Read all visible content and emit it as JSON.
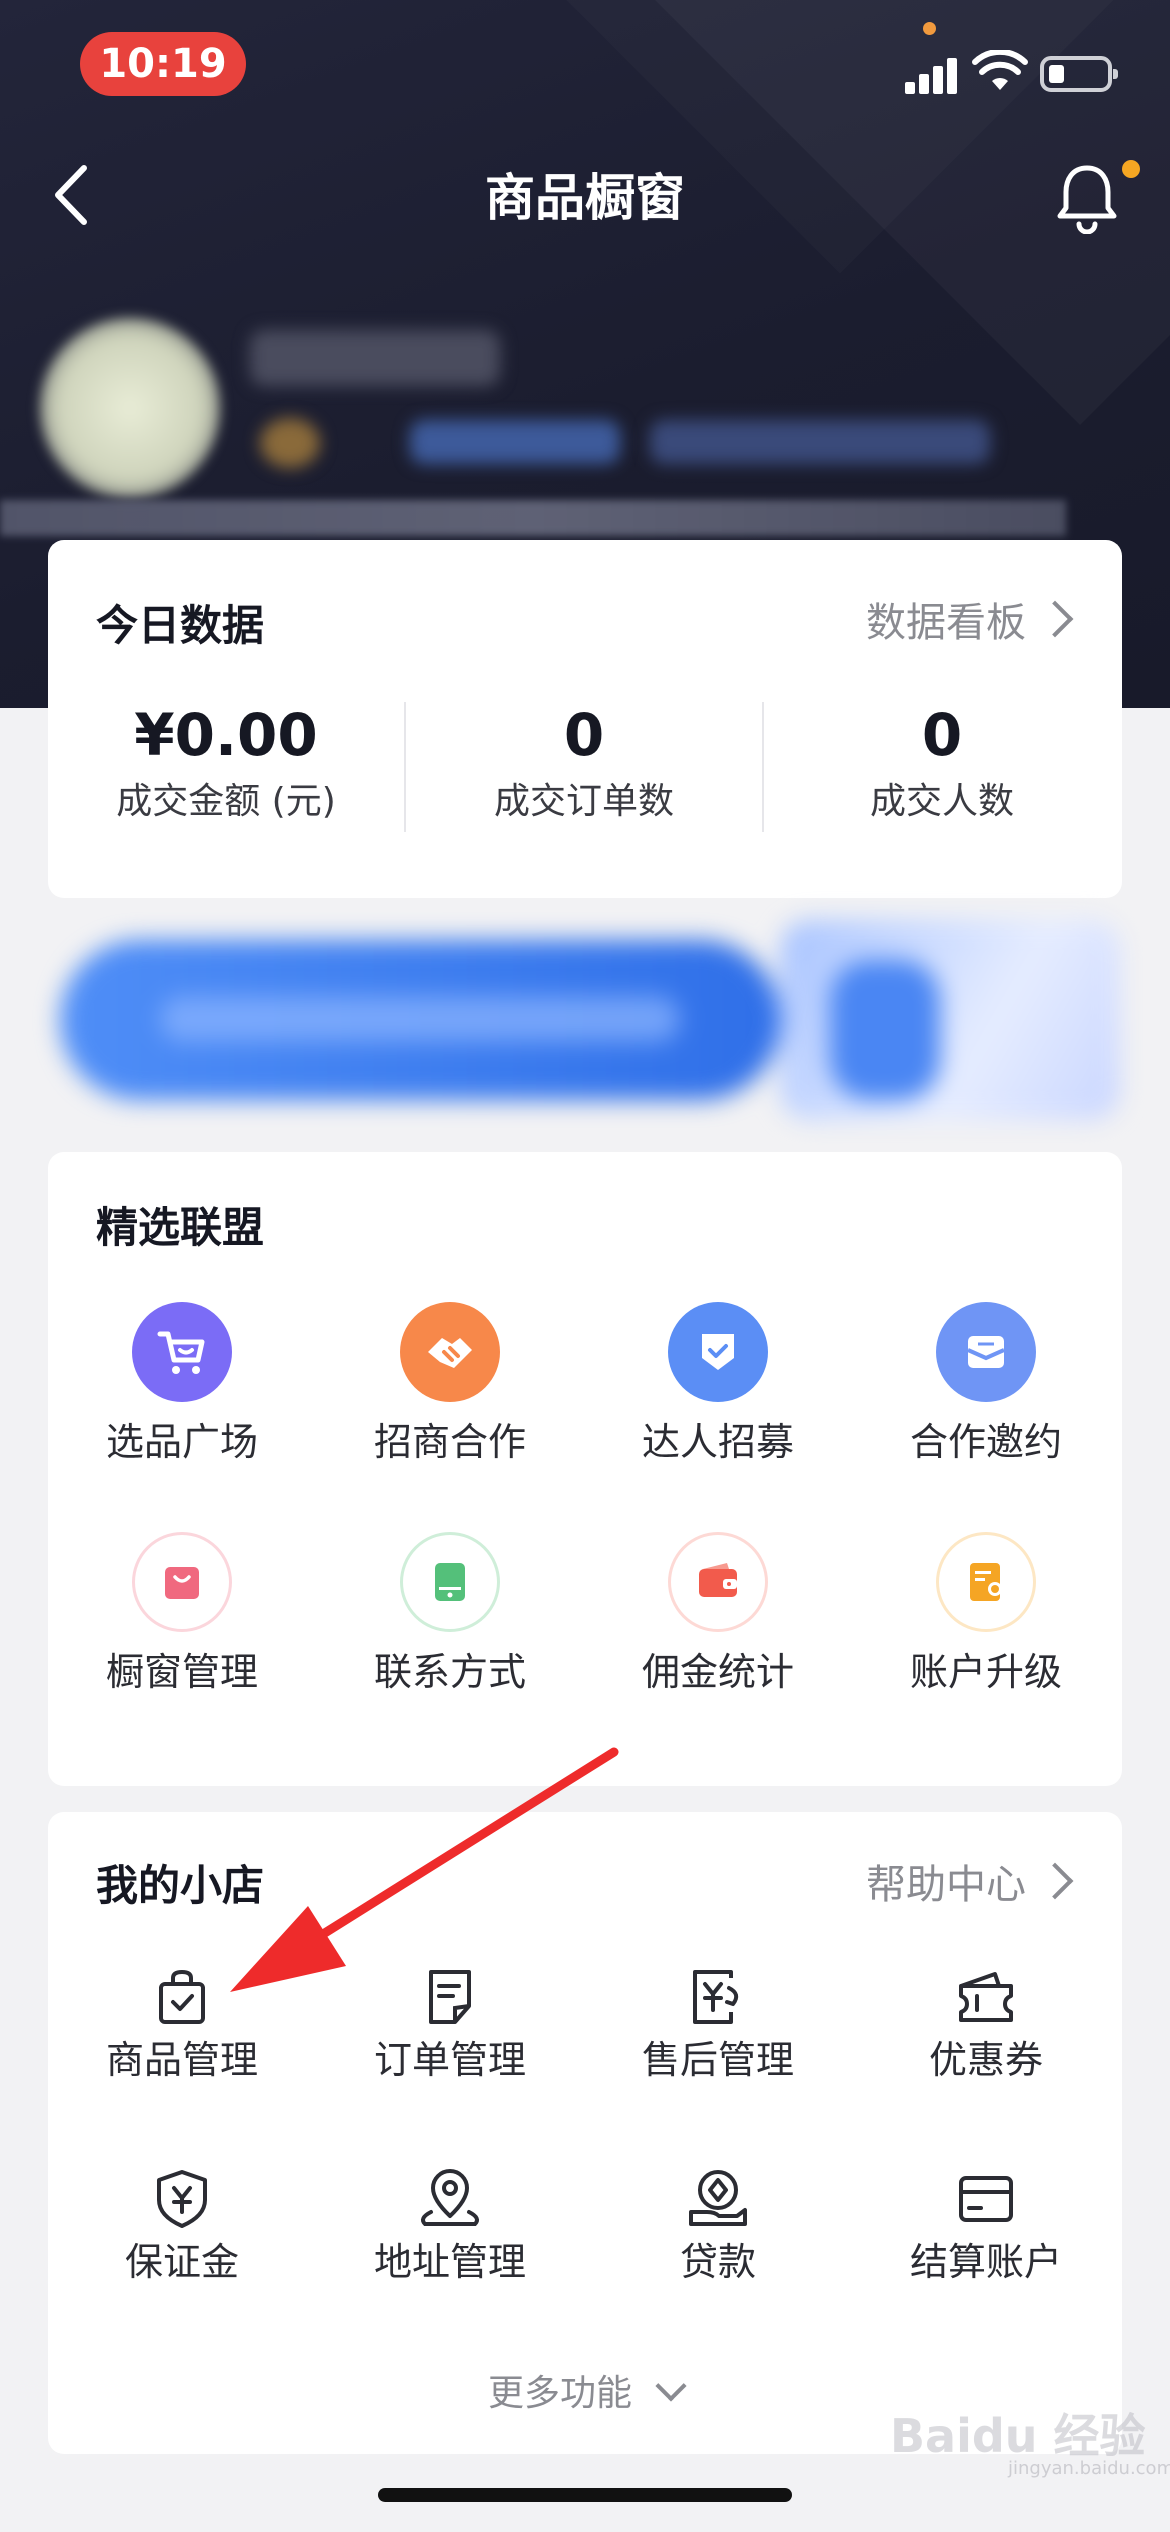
{
  "status_bar": {
    "time": "10:19"
  },
  "header": {
    "title": "商品橱窗"
  },
  "today": {
    "title": "今日数据",
    "link": "数据看板",
    "stats": [
      {
        "value": "¥0.00",
        "label": "成交金额 (元)"
      },
      {
        "value": "0",
        "label": "成交订单数"
      },
      {
        "value": "0",
        "label": "成交人数"
      }
    ]
  },
  "alliance": {
    "title": "精选联盟",
    "items": [
      {
        "label": "选品广场",
        "icon": "shopping-cart-icon",
        "color": "#7b6cf6"
      },
      {
        "label": "招商合作",
        "icon": "handshake-icon",
        "color": "#f7884a"
      },
      {
        "label": "达人招募",
        "icon": "shield-check-icon",
        "color": "#5b8ef5"
      },
      {
        "label": "合作邀约",
        "icon": "envelope-icon",
        "color": "#6f95f5"
      },
      {
        "label": "橱窗管理",
        "icon": "shopping-bag-icon",
        "color": "#f0697f"
      },
      {
        "label": "联系方式",
        "icon": "phone-card-icon",
        "color": "#54c07a"
      },
      {
        "label": "佣金统计",
        "icon": "wallet-icon",
        "color": "#f25b4c"
      },
      {
        "label": "账户升级",
        "icon": "certificate-icon",
        "color": "#f5a524"
      }
    ]
  },
  "shop": {
    "title": "我的小店",
    "link": "帮助中心",
    "items": [
      {
        "label": "商品管理",
        "icon": "bag-check-icon"
      },
      {
        "label": "订单管理",
        "icon": "order-list-icon"
      },
      {
        "label": "售后管理",
        "icon": "after-sale-icon"
      },
      {
        "label": "优惠券",
        "icon": "coupon-icon"
      },
      {
        "label": "保证金",
        "icon": "deposit-shield-icon"
      },
      {
        "label": "地址管理",
        "icon": "location-pin-icon"
      },
      {
        "label": "贷款",
        "icon": "loan-icon"
      },
      {
        "label": "结算账户",
        "icon": "bank-card-icon"
      }
    ],
    "more": "更多功能"
  },
  "watermark": {
    "brand": "Baidu 经验",
    "sub": "jingyan.baidu.com"
  }
}
